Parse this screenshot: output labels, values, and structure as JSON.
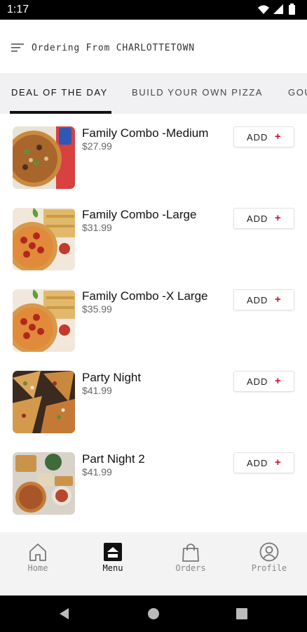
{
  "status_bar": {
    "time": "1:17"
  },
  "header": {
    "ordering_from": "Ordering From CHARLOTTETOWN"
  },
  "tabs": [
    {
      "label": "DEAL OF THE DAY",
      "active": true
    },
    {
      "label": "BUILD YOUR OWN PIZZA",
      "active": false
    },
    {
      "label": "GOU",
      "active": false
    }
  ],
  "items": [
    {
      "name": "Family Combo -Medium",
      "price": "$27.99",
      "add_label": "ADD",
      "image": "pizza-combo-soda"
    },
    {
      "name": "Family Combo -Large",
      "price": "$31.99",
      "add_label": "ADD",
      "image": "pepperoni-breadsticks"
    },
    {
      "name": "Family Combo -X Large",
      "price": "$35.99",
      "add_label": "ADD",
      "image": "pepperoni-breadsticks"
    },
    {
      "name": "Party Night",
      "price": "$41.99",
      "add_label": "ADD",
      "image": "pizza-slices"
    },
    {
      "name": "Part Night 2",
      "price": "$41.99",
      "add_label": "ADD",
      "image": "party-spread"
    }
  ],
  "bottom_nav": [
    {
      "label": "Home",
      "icon": "home-icon",
      "active": false
    },
    {
      "label": "Menu",
      "icon": "menu-icon",
      "active": true
    },
    {
      "label": "Orders",
      "icon": "bag-icon",
      "active": false
    },
    {
      "label": "Profile",
      "icon": "profile-icon",
      "active": false
    }
  ],
  "colors": {
    "accent": "#c8102e",
    "tab_bar": "#f1f1f3",
    "nav_bar": "#f3f3f3"
  }
}
